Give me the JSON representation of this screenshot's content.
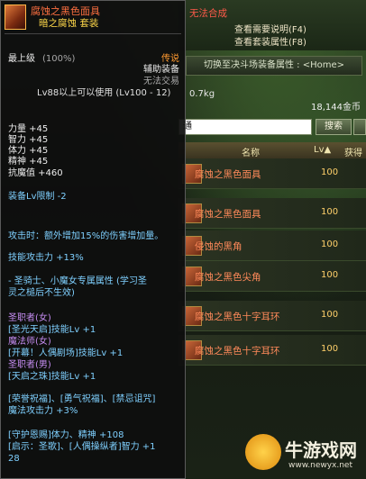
{
  "colors": {
    "item_name": "#ff7040",
    "set_name": "#ffd84a",
    "stat_white": "#eeeeee",
    "green": "#6adf5a",
    "purple": "#c48cf0",
    "cyan": "#7fd0ff",
    "red": "#ff5a4a"
  },
  "tooltip": {
    "icon": "face-mask-item-icon",
    "name": "腐蚀之黑色面具",
    "set_line": "暗之腐蚀  套装",
    "grade": "最上级",
    "grade_pct": "(100%)",
    "rarity": "传说",
    "category": "辅助装备",
    "trade": "无法交易",
    "level_req": "Lv88以上可以使用 (Lv100 - 12)",
    "weight": "0.7kg",
    "stats": {
      "str": "力量 +45",
      "int": "智力 +45",
      "vit": "体力 +45",
      "spi": "精神 +45",
      "anti_magic": "抗魔值 +460"
    },
    "equip_lv_limit": "装备Lv限制 -2",
    "damage_line1": "攻击时：额外增加15%的伤害增加量。",
    "skill_atk": "技能攻击力 +13%",
    "class_bonus_line1": "- 圣骑士、小魔女专属属性 (学习圣",
    "class_bonus_line2": "灵之槌后不生效)",
    "class_header": "圣职者(女)",
    "class_lines": [
      "[圣光天启]技能Lv +1",
      "魔法师(女)",
      "[开幕！人偶剧场]技能Lv +1",
      "圣职者(男)",
      "[天启之珠]技能Lv +1"
    ],
    "buff_line1": "[荣誉祝福]、[勇气祝福]、[禁忌诅咒]",
    "buff_line2": "魔法攻击力 +3%",
    "guard_line1": "[守护恩赐]体力、精神 +108",
    "guard_line2": "[启示：圣歌]、[人偶操纵者]智力 +1",
    "guard_line3": "28"
  },
  "auction": {
    "no_synth": "无法合成",
    "link_compare": "查看需要说明(F4)",
    "link_set": "查看套装属性(F8)",
    "switch_label": "切换至决斗场装备属性 : <Home>",
    "money": "18,144金币",
    "search_value": "通",
    "search_button": "搜索",
    "col_name": "名称",
    "col_lv": "Lv▲",
    "col_get": "获得",
    "rows": [
      {
        "name": "腐蚀之黑色面具",
        "lv": "100"
      },
      {
        "name": "腐蚀之黑色面具",
        "lv": "100"
      },
      {
        "name": "侵蚀的黑角",
        "lv": "100"
      },
      {
        "name": "腐蚀之黑色尖角",
        "lv": "100"
      },
      {
        "name": "腐蚀之黑色十字耳环",
        "lv": "100"
      },
      {
        "name": "腐蚀之黑色十字耳环",
        "lv": "100"
      }
    ]
  },
  "watermark": {
    "title": "牛游戏网",
    "url": "www.newyx.net"
  }
}
